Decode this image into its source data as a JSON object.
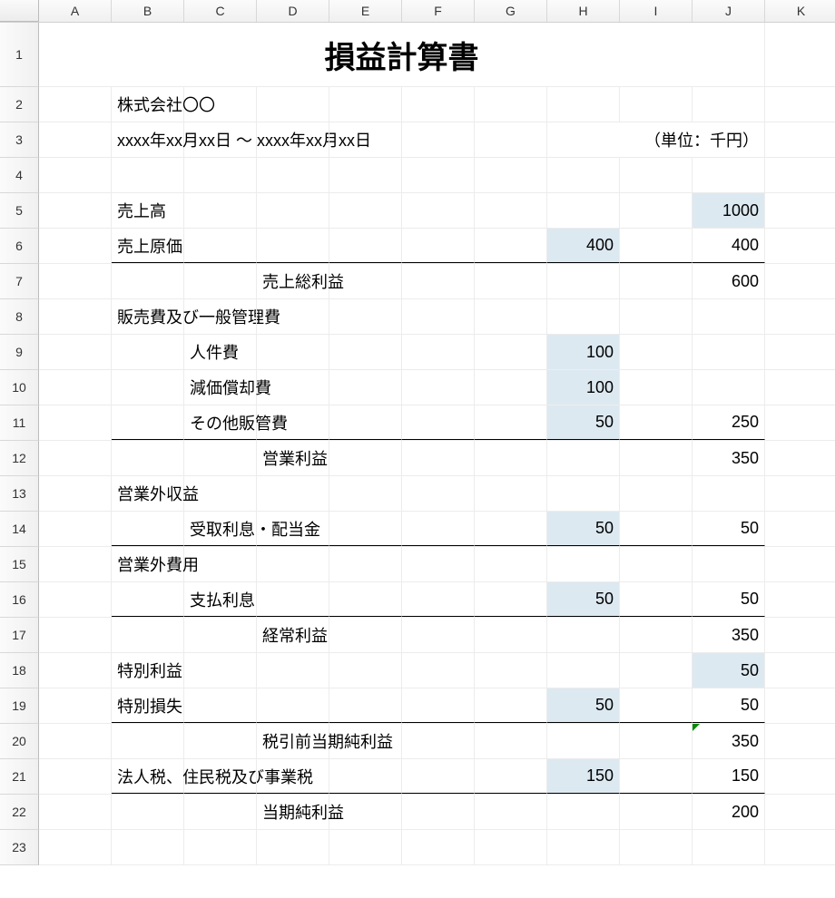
{
  "columns": [
    "A",
    "B",
    "C",
    "D",
    "E",
    "F",
    "G",
    "H",
    "I",
    "J",
    "K"
  ],
  "rows": [
    "1",
    "2",
    "3",
    "4",
    "5",
    "6",
    "7",
    "8",
    "9",
    "10",
    "11",
    "12",
    "13",
    "14",
    "15",
    "16",
    "17",
    "18",
    "19",
    "20",
    "21",
    "22",
    "23"
  ],
  "title": "損益計算書",
  "company": "株式会社〇〇",
  "period": "xxxx年xx月xx日 ～ xxxx年xx月xx日",
  "unit": "（単位：千円）",
  "lines": {
    "r5": {
      "labelB": "売上高",
      "J": "1000"
    },
    "r6": {
      "labelB": "売上原価",
      "H": "400",
      "J": "400"
    },
    "r7": {
      "labelD": "売上総利益",
      "J": "600"
    },
    "r8": {
      "labelB": "販売費及び一般管理費"
    },
    "r9": {
      "labelC": "人件費",
      "H": "100"
    },
    "r10": {
      "labelC": "減価償却費",
      "H": "100"
    },
    "r11": {
      "labelC": "その他販管費",
      "H": "50",
      "J": "250"
    },
    "r12": {
      "labelD": "営業利益",
      "J": "350"
    },
    "r13": {
      "labelB": "営業外収益"
    },
    "r14": {
      "labelC": "受取利息・配当金",
      "H": "50",
      "J": "50"
    },
    "r15": {
      "labelB": "営業外費用"
    },
    "r16": {
      "labelC": "支払利息",
      "H": "50",
      "J": "50"
    },
    "r17": {
      "labelD": "経常利益",
      "J": "350"
    },
    "r18": {
      "labelB": "特別利益",
      "J": "50"
    },
    "r19": {
      "labelB": "特別損失",
      "H": "50",
      "J": "50"
    },
    "r20": {
      "labelD": "税引前当期純利益",
      "J": "350"
    },
    "r21": {
      "labelB": "法人税、住民税及び事業税",
      "H": "150",
      "J": "150"
    },
    "r22": {
      "labelD": "当期純利益",
      "J": "200"
    }
  },
  "chart_data": {
    "type": "table",
    "title": "損益計算書",
    "unit": "千円",
    "rows": [
      {
        "item": "売上高",
        "subtotal": null,
        "total": 1000
      },
      {
        "item": "売上原価",
        "subtotal": 400,
        "total": 400
      },
      {
        "item": "売上総利益",
        "subtotal": null,
        "total": 600
      },
      {
        "item": "販売費及び一般管理費",
        "subtotal": null,
        "total": null
      },
      {
        "item": "人件費",
        "subtotal": 100,
        "total": null
      },
      {
        "item": "減価償却費",
        "subtotal": 100,
        "total": null
      },
      {
        "item": "その他販管費",
        "subtotal": 50,
        "total": 250
      },
      {
        "item": "営業利益",
        "subtotal": null,
        "total": 350
      },
      {
        "item": "営業外収益",
        "subtotal": null,
        "total": null
      },
      {
        "item": "受取利息・配当金",
        "subtotal": 50,
        "total": 50
      },
      {
        "item": "営業外費用",
        "subtotal": null,
        "total": null
      },
      {
        "item": "支払利息",
        "subtotal": 50,
        "total": 50
      },
      {
        "item": "経常利益",
        "subtotal": null,
        "total": 350
      },
      {
        "item": "特別利益",
        "subtotal": null,
        "total": 50
      },
      {
        "item": "特別損失",
        "subtotal": 50,
        "total": 50
      },
      {
        "item": "税引前当期純利益",
        "subtotal": null,
        "total": 350
      },
      {
        "item": "法人税、住民税及び事業税",
        "subtotal": 150,
        "total": 150
      },
      {
        "item": "当期純利益",
        "subtotal": null,
        "total": 200
      }
    ]
  }
}
